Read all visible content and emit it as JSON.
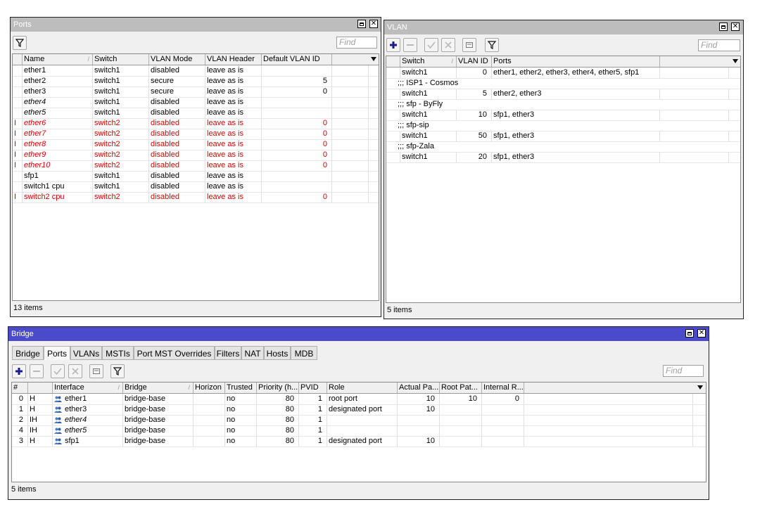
{
  "ports": {
    "title": "Ports",
    "find_placeholder": "Find",
    "columns": [
      "Name",
      "Switch",
      "VLAN Mode",
      "VLAN Header",
      "Default VLAN ID"
    ],
    "rows": [
      {
        "flag": "",
        "name": "ether1",
        "switch": "switch1",
        "mode": "disabled",
        "header": "leave as is",
        "vid": ""
      },
      {
        "flag": "",
        "name": "ether2",
        "switch": "switch1",
        "mode": "secure",
        "header": "leave as is",
        "vid": "5"
      },
      {
        "flag": "",
        "name": "ether3",
        "switch": "switch1",
        "mode": "secure",
        "header": "leave as is",
        "vid": "0"
      },
      {
        "flag": "",
        "name": "ether4",
        "switch": "switch1",
        "mode": "disabled",
        "header": "leave as is",
        "vid": ""
      },
      {
        "flag": "",
        "name": "ether5",
        "switch": "switch1",
        "mode": "disabled",
        "header": "leave as is",
        "vid": ""
      },
      {
        "flag": "I",
        "name": "ether6",
        "switch": "switch2",
        "mode": "disabled",
        "header": "leave as is",
        "vid": "0"
      },
      {
        "flag": "I",
        "name": "ether7",
        "switch": "switch2",
        "mode": "disabled",
        "header": "leave as is",
        "vid": "0"
      },
      {
        "flag": "I",
        "name": "ether8",
        "switch": "switch2",
        "mode": "disabled",
        "header": "leave as is",
        "vid": "0"
      },
      {
        "flag": "I",
        "name": "ether9",
        "switch": "switch2",
        "mode": "disabled",
        "header": "leave as is",
        "vid": "0"
      },
      {
        "flag": "I",
        "name": "ether10",
        "switch": "switch2",
        "mode": "disabled",
        "header": "leave as is",
        "vid": "0"
      },
      {
        "flag": "",
        "name": "sfp1",
        "switch": "switch1",
        "mode": "disabled",
        "header": "leave as is",
        "vid": ""
      },
      {
        "flag": "",
        "name": "switch1 cpu",
        "switch": "switch1",
        "mode": "disabled",
        "header": "leave as is",
        "vid": ""
      },
      {
        "flag": "I",
        "name": "switch2 cpu",
        "switch": "switch2",
        "mode": "disabled",
        "header": "leave as is",
        "vid": "0"
      }
    ],
    "status": "13 items"
  },
  "vlan": {
    "title": "VLAN",
    "find_placeholder": "Find",
    "columns": [
      "Switch",
      "VLAN ID",
      "Ports"
    ],
    "rows": [
      {
        "type": "data",
        "switch": "switch1",
        "vid": "0",
        "ports": "ether1, ether2, ether3, ether4, ether5, sfp1"
      },
      {
        "type": "comment",
        "text": ";;; ISP1 - Cosmos"
      },
      {
        "type": "data",
        "switch": "switch1",
        "vid": "5",
        "ports": "ether2, ether3"
      },
      {
        "type": "comment",
        "text": ";;; sfp - ByFly"
      },
      {
        "type": "data",
        "switch": "switch1",
        "vid": "10",
        "ports": "sfp1, ether3"
      },
      {
        "type": "comment",
        "text": ";;; sfp-sip"
      },
      {
        "type": "data",
        "switch": "switch1",
        "vid": "50",
        "ports": "sfp1, ether3"
      },
      {
        "type": "comment",
        "text": ";;; sfp-Zala"
      },
      {
        "type": "data",
        "switch": "switch1",
        "vid": "20",
        "ports": "sfp1, ether3"
      }
    ],
    "status": "5 items"
  },
  "bridge": {
    "title": "Bridge",
    "tabs": [
      "Bridge",
      "Ports",
      "VLANs",
      "MSTIs",
      "Port MST Overrides",
      "Filters",
      "NAT",
      "Hosts",
      "MDB"
    ],
    "selected_tab": "Ports",
    "find_placeholder": "Find",
    "columns": [
      "#",
      "",
      "Interface",
      "Bridge",
      "Horizon",
      "Trusted",
      "Priority (h...",
      "PVID",
      "Role",
      "Actual Pa...",
      "Root Pat...",
      "Internal R..."
    ],
    "rows": [
      {
        "num": "0",
        "flags": "H",
        "iface": "ether1",
        "bridge": "bridge-base",
        "horizon": "",
        "trusted": "no",
        "priority": "80",
        "pvid": "1",
        "role": "root port",
        "actual": "10",
        "rootpath": "10",
        "internal": "0",
        "italic": false
      },
      {
        "num": "1",
        "flags": "H",
        "iface": "ether3",
        "bridge": "bridge-base",
        "horizon": "",
        "trusted": "no",
        "priority": "80",
        "pvid": "1",
        "role": "designated port",
        "actual": "10",
        "rootpath": "",
        "internal": "",
        "italic": false
      },
      {
        "num": "2",
        "flags": "IH",
        "iface": "ether4",
        "bridge": "bridge-base",
        "horizon": "",
        "trusted": "no",
        "priority": "80",
        "pvid": "1",
        "role": "",
        "actual": "",
        "rootpath": "",
        "internal": "",
        "italic": true
      },
      {
        "num": "4",
        "flags": "IH",
        "iface": "ether5",
        "bridge": "bridge-base",
        "horizon": "",
        "trusted": "no",
        "priority": "80",
        "pvid": "1",
        "role": "",
        "actual": "",
        "rootpath": "",
        "internal": "",
        "italic": true
      },
      {
        "num": "3",
        "flags": "H",
        "iface": "sfp1",
        "bridge": "bridge-base",
        "horizon": "",
        "trusted": "no",
        "priority": "80",
        "pvid": "1",
        "role": "designated port",
        "actual": "10",
        "rootpath": "",
        "internal": "",
        "italic": false
      }
    ],
    "status": "5 items"
  },
  "colors": {
    "active_title": "#4a4acb",
    "inactive_title": "#bdbdbd",
    "disabled_text": "#d80000",
    "add_icon": "#1a1a8c"
  }
}
